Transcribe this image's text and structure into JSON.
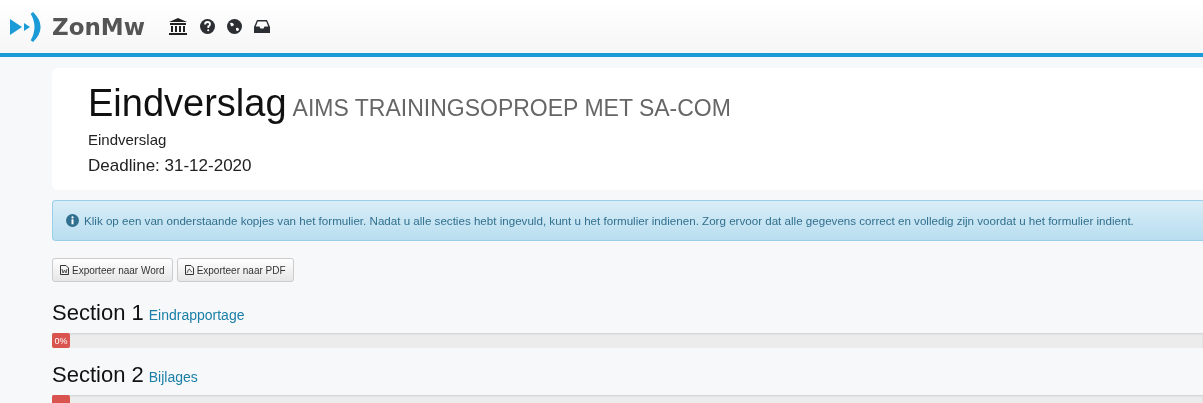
{
  "header": {
    "logo_text": "ZonMw"
  },
  "card": {
    "title": "Eindverslag",
    "subtitle": "AIMS TRAININGSOPROEP MET SA-COM",
    "form_name": "Eindverslag",
    "deadline": "Deadline: 31-12-2020"
  },
  "alert": {
    "text": "Klik op een van onderstaande kopjes van het formulier. Nadat u alle secties hebt ingevuld, kunt u het formulier indienen. Zorg ervoor dat alle gegevens correct en volledig zijn voordat u het formulier indient."
  },
  "buttons": [
    {
      "label": "Exporteer naar Word",
      "kind": "word"
    },
    {
      "label": "Exporteer naar PDF",
      "kind": "pdf"
    }
  ],
  "sections": [
    {
      "label": "Section",
      "number": "1",
      "link": "Eindrapportage",
      "level": 0,
      "progress_text": "0%"
    },
    {
      "label": "Section",
      "number": "2",
      "link": "Bijlages",
      "level": 0
    }
  ]
}
